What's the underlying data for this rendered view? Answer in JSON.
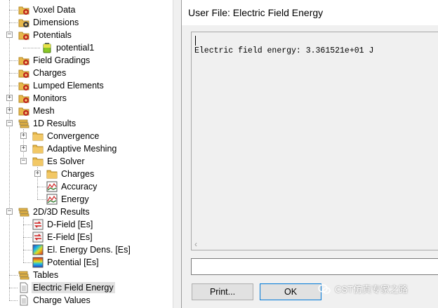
{
  "tree": {
    "items": [
      {
        "label": "Voxel Data",
        "icon": "folder-red-gear-icon"
      },
      {
        "label": "Dimensions",
        "icon": "folder-gear-icon"
      },
      {
        "label": "Potentials",
        "icon": "folder-red-gear-icon",
        "expanded": true
      },
      {
        "label": "potential1",
        "icon": "battery-icon"
      },
      {
        "label": "Field Gradings",
        "icon": "folder-red-gear-icon"
      },
      {
        "label": "Charges",
        "icon": "folder-red-gear-icon"
      },
      {
        "label": "Lumped Elements",
        "icon": "folder-red-gear-icon"
      },
      {
        "label": "Monitors",
        "icon": "folder-red-gear-icon",
        "expanded": false
      },
      {
        "label": "Mesh",
        "icon": "folder-red-gear-icon",
        "expanded": false
      },
      {
        "label": "1D Results",
        "icon": "stacked-folder-icon",
        "expanded": true
      },
      {
        "label": "Convergence",
        "icon": "folder-icon",
        "expanded": false
      },
      {
        "label": "Adaptive Meshing",
        "icon": "folder-icon",
        "expanded": false
      },
      {
        "label": "Es Solver",
        "icon": "folder-icon",
        "expanded": true
      },
      {
        "label": "Charges",
        "icon": "folder-icon",
        "expanded": false
      },
      {
        "label": "Accuracy",
        "icon": "line-chart-icon"
      },
      {
        "label": "Energy",
        "icon": "line-chart-icon"
      },
      {
        "label": "2D/3D Results",
        "icon": "stacked-folder-icon",
        "expanded": true
      },
      {
        "label": "D-Field [Es]",
        "icon": "vector-field-icon"
      },
      {
        "label": "E-Field [Es]",
        "icon": "vector-field-icon"
      },
      {
        "label": "El. Energy Dens. [Es]",
        "icon": "scalar-field-icon"
      },
      {
        "label": "Potential [Es]",
        "icon": "scalar-field-icon"
      },
      {
        "label": "Tables",
        "icon": "stacked-folder-icon"
      },
      {
        "label": "Electric Field Energy",
        "icon": "document-icon",
        "selected": true
      },
      {
        "label": "Charge Values",
        "icon": "document-icon"
      }
    ]
  },
  "dialog": {
    "title": "User File: Electric Field Energy",
    "content": "Electric field energy: 3.361521e+01 J",
    "input_value": "",
    "print_label": "Print...",
    "ok_label": "OK"
  },
  "watermark": {
    "text": "CST仿真专家之路"
  },
  "colors": {
    "folder": "#e8b84a",
    "gear": "#c0281c",
    "selection": "#e1e1e1",
    "ok_border": "#0078d7"
  }
}
